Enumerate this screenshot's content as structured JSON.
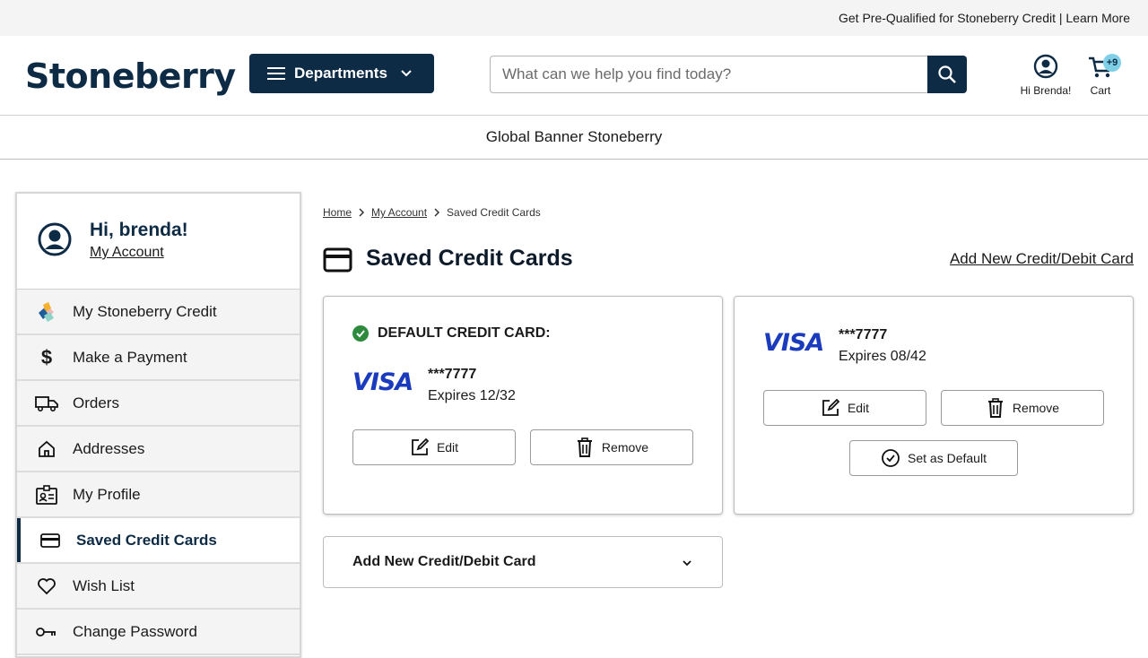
{
  "topbar": {
    "promo": "Get Pre-Qualified for Stoneberry Credit | Learn More"
  },
  "header": {
    "logo_text": "Stoneberry",
    "departments_label": "Departments",
    "search_placeholder": "What can we help you find today?",
    "account_label": "Hi Brenda!",
    "cart_label": "Cart",
    "cart_count": "+9"
  },
  "banner": {
    "text": "Global Banner Stoneberry"
  },
  "sidebar": {
    "greeting": "Hi, brenda!",
    "my_account": "My Account",
    "items": [
      {
        "label": "My Stoneberry Credit",
        "icon": "stoneberry-logo-icon"
      },
      {
        "label": "Make a Payment",
        "icon": "dollar-icon"
      },
      {
        "label": "Orders",
        "icon": "truck-icon"
      },
      {
        "label": "Addresses",
        "icon": "home-icon"
      },
      {
        "label": "My Profile",
        "icon": "profile-card-icon"
      },
      {
        "label": "Saved Credit Cards",
        "icon": "credit-card-icon",
        "active": true
      },
      {
        "label": "Wish List",
        "icon": "heart-icon"
      },
      {
        "label": "Change Password",
        "icon": "key-icon"
      }
    ]
  },
  "breadcrumb": {
    "home": "Home",
    "account": "My Account",
    "current": "Saved Credit Cards"
  },
  "page": {
    "title": "Saved Credit Cards",
    "add_link": "Add New Credit/Debit Card"
  },
  "cards": [
    {
      "default_label": "DEFAULT CREDIT CARD:",
      "brand": "VISA",
      "number": "***7777",
      "expires": "Expires 12/32",
      "edit": "Edit",
      "remove": "Remove"
    },
    {
      "brand": "VISA",
      "number": "***7777",
      "expires": "Expires 08/42",
      "edit": "Edit",
      "remove": "Remove",
      "set_default": "Set as Default"
    }
  ],
  "accordion": {
    "label": "Add New Credit/Debit Card"
  },
  "colors": {
    "navy": "#0d2b45",
    "visa_blue": "#1a3bbd",
    "check_green": "#2e8b3e",
    "badge": "#7fd0e6"
  }
}
